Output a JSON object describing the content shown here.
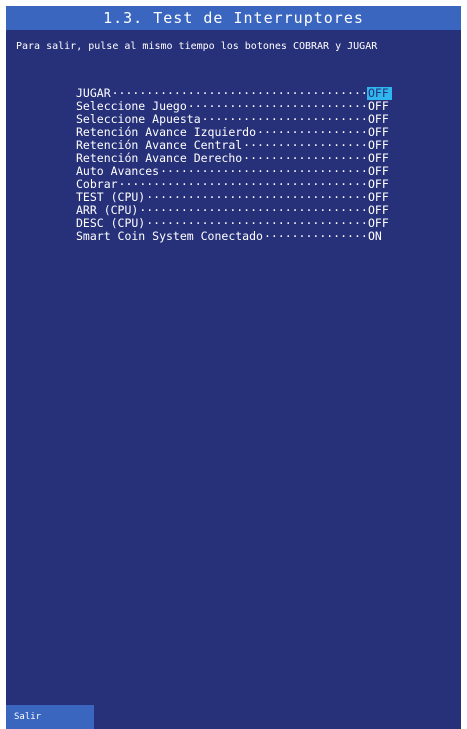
{
  "title": "1.3. Test de Interruptores",
  "instructions": "Para salir, pulse al mismo tiempo los botones COBRAR y JUGAR",
  "switches": [
    {
      "label": "JUGAR",
      "state": "OFF"
    },
    {
      "label": "Seleccione Juego",
      "state": "OFF"
    },
    {
      "label": "Seleccione Apuesta",
      "state": "OFF"
    },
    {
      "label": "Retención Avance Izquierdo",
      "state": "OFF"
    },
    {
      "label": "Retención Avance Central",
      "state": "OFF"
    },
    {
      "label": "Retención Avance Derecho",
      "state": "OFF"
    },
    {
      "label": "Auto Avances",
      "state": "OFF"
    },
    {
      "label": "Cobrar",
      "state": "OFF"
    },
    {
      "label": "TEST (CPU)",
      "state": "OFF"
    },
    {
      "label": "ARR (CPU)",
      "state": "OFF"
    },
    {
      "label": "DESC (CPU)",
      "state": "OFF"
    },
    {
      "label": "Smart Coin System Conectado",
      "state": "ON"
    }
  ],
  "selected_state_color": "#2fb6ee",
  "background_color": "#27317a",
  "bar_color": "#3a66c0",
  "exit_button_label": "Salir"
}
